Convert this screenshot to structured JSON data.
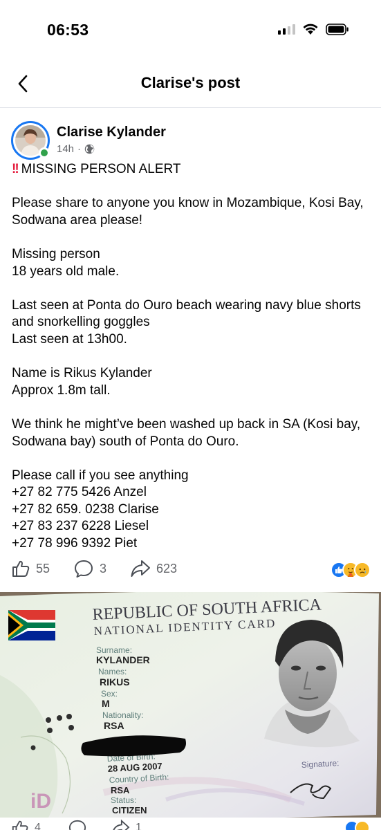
{
  "status_bar": {
    "time": "06:53"
  },
  "nav": {
    "title": "Clarise's post"
  },
  "post": {
    "author": "Clarise Kylander",
    "time_ago": "14h",
    "separator": "·",
    "alert_marker": "!!",
    "body": [
      "MISSING PERSON ALERT",
      "",
      "Please share to anyone you know in Mozambique, Kosi Bay, Sodwana area please!",
      "",
      "Missing person",
      "18 years old male.",
      "",
      "Last seen at Ponta do Ouro beach wearing navy blue shorts and snorkelling goggles",
      "Last seen at 13h00.",
      "",
      "Name is Rikus Kylander",
      "Approx 1.8m tall.",
      "",
      "We think he might’ve been washed up back in SA (Kosi bay, Sodwana bay) south of Ponta do Ouro.",
      "",
      "Please call if you see anything",
      "+27 82 775 5426 Anzel",
      "+27 82 659. 0238 Clarise",
      "+27 83 237 6228 Liesel",
      "+27 78 996 9392 Piet"
    ],
    "likes": "55",
    "comments": "3",
    "shares": "623",
    "reactions": [
      "like-icon",
      "care-icon",
      "sad-icon"
    ]
  },
  "id_card": {
    "title_line1": "REPUBLIC OF SOUTH AFRICA",
    "title_line2": "NATIONAL IDENTITY CARD",
    "surname_label": "Surname:",
    "surname": "KYLANDER",
    "names_label": "Names:",
    "names": "RIKUS",
    "sex_label": "Sex:",
    "sex": "M",
    "nationality_label": "Nationality:",
    "nationality": "RSA",
    "dob_label": "Date of Birth:",
    "dob": "28 AUG 2007",
    "cob_label": "Country of Birth:",
    "cob": "RSA",
    "status_label": "Status:",
    "status": "CITIZEN",
    "signature_label": "Signature:",
    "logo_text": "iD"
  },
  "bottom_partial": {
    "likes": "4",
    "shares": "1"
  },
  "colors": {
    "facebook_blue": "#1877f2",
    "online_green": "#31a24c",
    "alert_red": "#e41e3f",
    "secondary_text": "#65676b"
  }
}
